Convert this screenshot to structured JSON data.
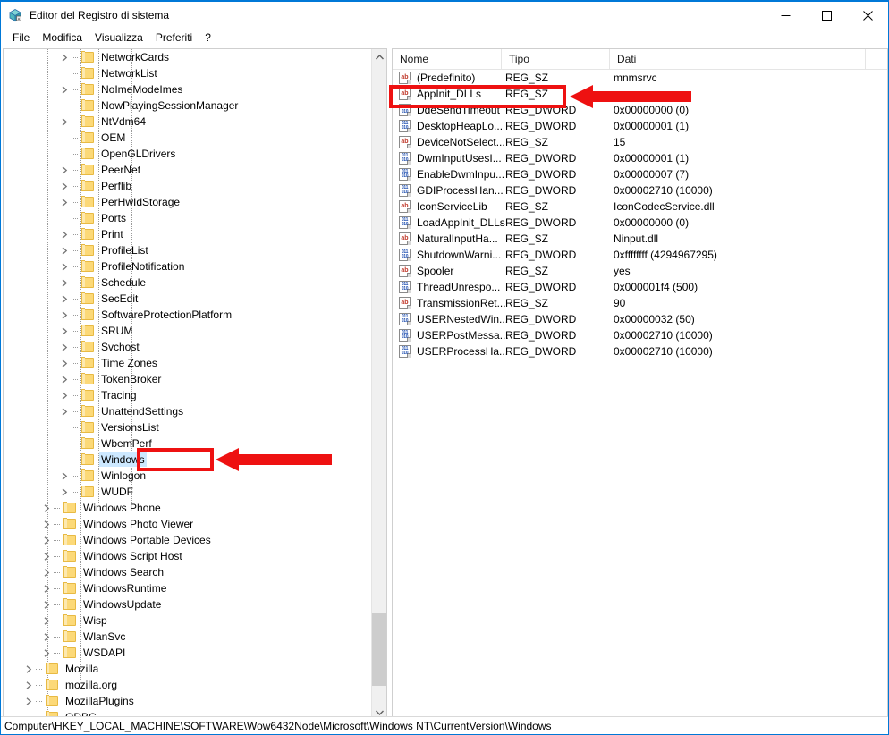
{
  "window": {
    "title": "Editor del Registro di sistema",
    "icon": "regedit-icon",
    "minimize_label": "—",
    "maximize_label": "□",
    "close_label": "✕"
  },
  "menubar": {
    "items": [
      {
        "label": "File",
        "name": "menu-file"
      },
      {
        "label": "Modifica",
        "name": "menu-modifica"
      },
      {
        "label": "Visualizza",
        "name": "menu-visualizza"
      },
      {
        "label": "Preferiti",
        "name": "menu-preferiti"
      },
      {
        "label": "?",
        "name": "menu-help"
      }
    ]
  },
  "tree": {
    "items": [
      {
        "label": "NetworkCards",
        "indent": 5,
        "chevron": true,
        "selected": false
      },
      {
        "label": "NetworkList",
        "indent": 5,
        "chevron": false,
        "selected": false
      },
      {
        "label": "NoImeModeImes",
        "indent": 5,
        "chevron": true,
        "selected": false
      },
      {
        "label": "NowPlayingSessionManager",
        "indent": 5,
        "chevron": false,
        "selected": false
      },
      {
        "label": "NtVdm64",
        "indent": 5,
        "chevron": true,
        "selected": false
      },
      {
        "label": "OEM",
        "indent": 5,
        "chevron": false,
        "selected": false
      },
      {
        "label": "OpenGLDrivers",
        "indent": 5,
        "chevron": false,
        "selected": false
      },
      {
        "label": "PeerNet",
        "indent": 5,
        "chevron": true,
        "selected": false
      },
      {
        "label": "Perflib",
        "indent": 5,
        "chevron": true,
        "selected": false
      },
      {
        "label": "PerHwIdStorage",
        "indent": 5,
        "chevron": true,
        "selected": false
      },
      {
        "label": "Ports",
        "indent": 5,
        "chevron": false,
        "selected": false
      },
      {
        "label": "Print",
        "indent": 5,
        "chevron": true,
        "selected": false
      },
      {
        "label": "ProfileList",
        "indent": 5,
        "chevron": true,
        "selected": false
      },
      {
        "label": "ProfileNotification",
        "indent": 5,
        "chevron": true,
        "selected": false
      },
      {
        "label": "Schedule",
        "indent": 5,
        "chevron": true,
        "selected": false
      },
      {
        "label": "SecEdit",
        "indent": 5,
        "chevron": true,
        "selected": false
      },
      {
        "label": "SoftwareProtectionPlatform",
        "indent": 5,
        "chevron": true,
        "selected": false
      },
      {
        "label": "SRUM",
        "indent": 5,
        "chevron": true,
        "selected": false
      },
      {
        "label": "Svchost",
        "indent": 5,
        "chevron": true,
        "selected": false
      },
      {
        "label": "Time Zones",
        "indent": 5,
        "chevron": true,
        "selected": false
      },
      {
        "label": "TokenBroker",
        "indent": 5,
        "chevron": true,
        "selected": false
      },
      {
        "label": "Tracing",
        "indent": 5,
        "chevron": true,
        "selected": false
      },
      {
        "label": "UnattendSettings",
        "indent": 5,
        "chevron": true,
        "selected": false
      },
      {
        "label": "VersionsList",
        "indent": 5,
        "chevron": false,
        "selected": false
      },
      {
        "label": "WbemPerf",
        "indent": 5,
        "chevron": false,
        "selected": false
      },
      {
        "label": "Windows",
        "indent": 5,
        "chevron": false,
        "selected": true
      },
      {
        "label": "Winlogon",
        "indent": 5,
        "chevron": true,
        "selected": false
      },
      {
        "label": "WUDF",
        "indent": 5,
        "chevron": true,
        "selected": false
      },
      {
        "label": "Windows Phone",
        "indent": 4,
        "chevron": true,
        "selected": false
      },
      {
        "label": "Windows Photo Viewer",
        "indent": 4,
        "chevron": true,
        "selected": false
      },
      {
        "label": "Windows Portable Devices",
        "indent": 4,
        "chevron": true,
        "selected": false
      },
      {
        "label": "Windows Script Host",
        "indent": 4,
        "chevron": true,
        "selected": false
      },
      {
        "label": "Windows Search",
        "indent": 4,
        "chevron": true,
        "selected": false
      },
      {
        "label": "WindowsRuntime",
        "indent": 4,
        "chevron": true,
        "selected": false
      },
      {
        "label": "WindowsUpdate",
        "indent": 4,
        "chevron": true,
        "selected": false
      },
      {
        "label": "Wisp",
        "indent": 4,
        "chevron": true,
        "selected": false
      },
      {
        "label": "WlanSvc",
        "indent": 4,
        "chevron": true,
        "selected": false
      },
      {
        "label": "WSDAPI",
        "indent": 4,
        "chevron": true,
        "selected": false
      },
      {
        "label": "Mozilla",
        "indent": 3,
        "chevron": true,
        "selected": false
      },
      {
        "label": "mozilla.org",
        "indent": 3,
        "chevron": true,
        "selected": false
      },
      {
        "label": "MozillaPlugins",
        "indent": 3,
        "chevron": true,
        "selected": false
      },
      {
        "label": "ODBC",
        "indent": 3,
        "chevron": false,
        "selected": false
      }
    ],
    "scrollbar": {
      "up_arrow": "chevron-up-icon",
      "down_arrow": "chevron-down-icon"
    }
  },
  "list": {
    "columns": [
      {
        "label": "Nome",
        "name": "column-header-nome"
      },
      {
        "label": "Tipo",
        "name": "column-header-tipo"
      },
      {
        "label": "Dati",
        "name": "column-header-dati"
      }
    ],
    "rows": [
      {
        "name": "(Predefinito)",
        "type": "REG_SZ",
        "data": "mnmsrvc",
        "icon": "string-value-icon",
        "glyph": "ab"
      },
      {
        "name": "AppInit_DLLs",
        "type": "REG_SZ",
        "data": "",
        "icon": "string-value-icon",
        "glyph": "ab"
      },
      {
        "name": "DdeSendTimeout",
        "type": "REG_DWORD",
        "data": "0x00000000 (0)",
        "icon": "dword-value-icon",
        "glyph": "0110"
      },
      {
        "name": "DesktopHeapLo...",
        "type": "REG_DWORD",
        "data": "0x00000001 (1)",
        "icon": "dword-value-icon",
        "glyph": "0110"
      },
      {
        "name": "DeviceNotSelect...",
        "type": "REG_SZ",
        "data": "15",
        "icon": "string-value-icon",
        "glyph": "ab"
      },
      {
        "name": "DwmInputUsesI...",
        "type": "REG_DWORD",
        "data": "0x00000001 (1)",
        "icon": "dword-value-icon",
        "glyph": "0110"
      },
      {
        "name": "EnableDwmInpu...",
        "type": "REG_DWORD",
        "data": "0x00000007 (7)",
        "icon": "dword-value-icon",
        "glyph": "0110"
      },
      {
        "name": "GDIProcessHan...",
        "type": "REG_DWORD",
        "data": "0x00002710 (10000)",
        "icon": "dword-value-icon",
        "glyph": "0110"
      },
      {
        "name": "IconServiceLib",
        "type": "REG_SZ",
        "data": "IconCodecService.dll",
        "icon": "string-value-icon",
        "glyph": "ab"
      },
      {
        "name": "LoadAppInit_DLLs",
        "type": "REG_DWORD",
        "data": "0x00000000 (0)",
        "icon": "dword-value-icon",
        "glyph": "0110"
      },
      {
        "name": "NaturalInputHa...",
        "type": "REG_SZ",
        "data": "Ninput.dll",
        "icon": "string-value-icon",
        "glyph": "ab"
      },
      {
        "name": "ShutdownWarni...",
        "type": "REG_DWORD",
        "data": "0xffffffff (4294967295)",
        "icon": "dword-value-icon",
        "glyph": "0110"
      },
      {
        "name": "Spooler",
        "type": "REG_SZ",
        "data": "yes",
        "icon": "string-value-icon",
        "glyph": "ab"
      },
      {
        "name": "ThreadUnrespo...",
        "type": "REG_DWORD",
        "data": "0x000001f4 (500)",
        "icon": "dword-value-icon",
        "glyph": "0110"
      },
      {
        "name": "TransmissionRet...",
        "type": "REG_SZ",
        "data": "90",
        "icon": "string-value-icon",
        "glyph": "ab"
      },
      {
        "name": "USERNestedWin...",
        "type": "REG_DWORD",
        "data": "0x00000032 (50)",
        "icon": "dword-value-icon",
        "glyph": "0110"
      },
      {
        "name": "USERPostMessa...",
        "type": "REG_DWORD",
        "data": "0x00002710 (10000)",
        "icon": "dword-value-icon",
        "glyph": "0110"
      },
      {
        "name": "USERProcessHa...",
        "type": "REG_DWORD",
        "data": "0x00002710 (10000)",
        "icon": "dword-value-icon",
        "glyph": "0110"
      }
    ]
  },
  "statusbar": {
    "path": "Computer\\HKEY_LOCAL_MACHINE\\SOFTWARE\\Wow6432Node\\Microsoft\\Windows NT\\CurrentVersion\\Windows"
  },
  "annotations": {
    "accent_color": "#ee1111",
    "highlight_color": "#cce8ff",
    "items": [
      {
        "name": "annotation-box-appinit-dlls",
        "target": "AppInit_DLLs"
      },
      {
        "name": "annotation-arrow-appinit-dlls",
        "target": "AppInit_DLLs"
      },
      {
        "name": "annotation-box-windows-key",
        "target": "Windows"
      },
      {
        "name": "annotation-arrow-windows-key",
        "target": "Windows"
      }
    ]
  }
}
